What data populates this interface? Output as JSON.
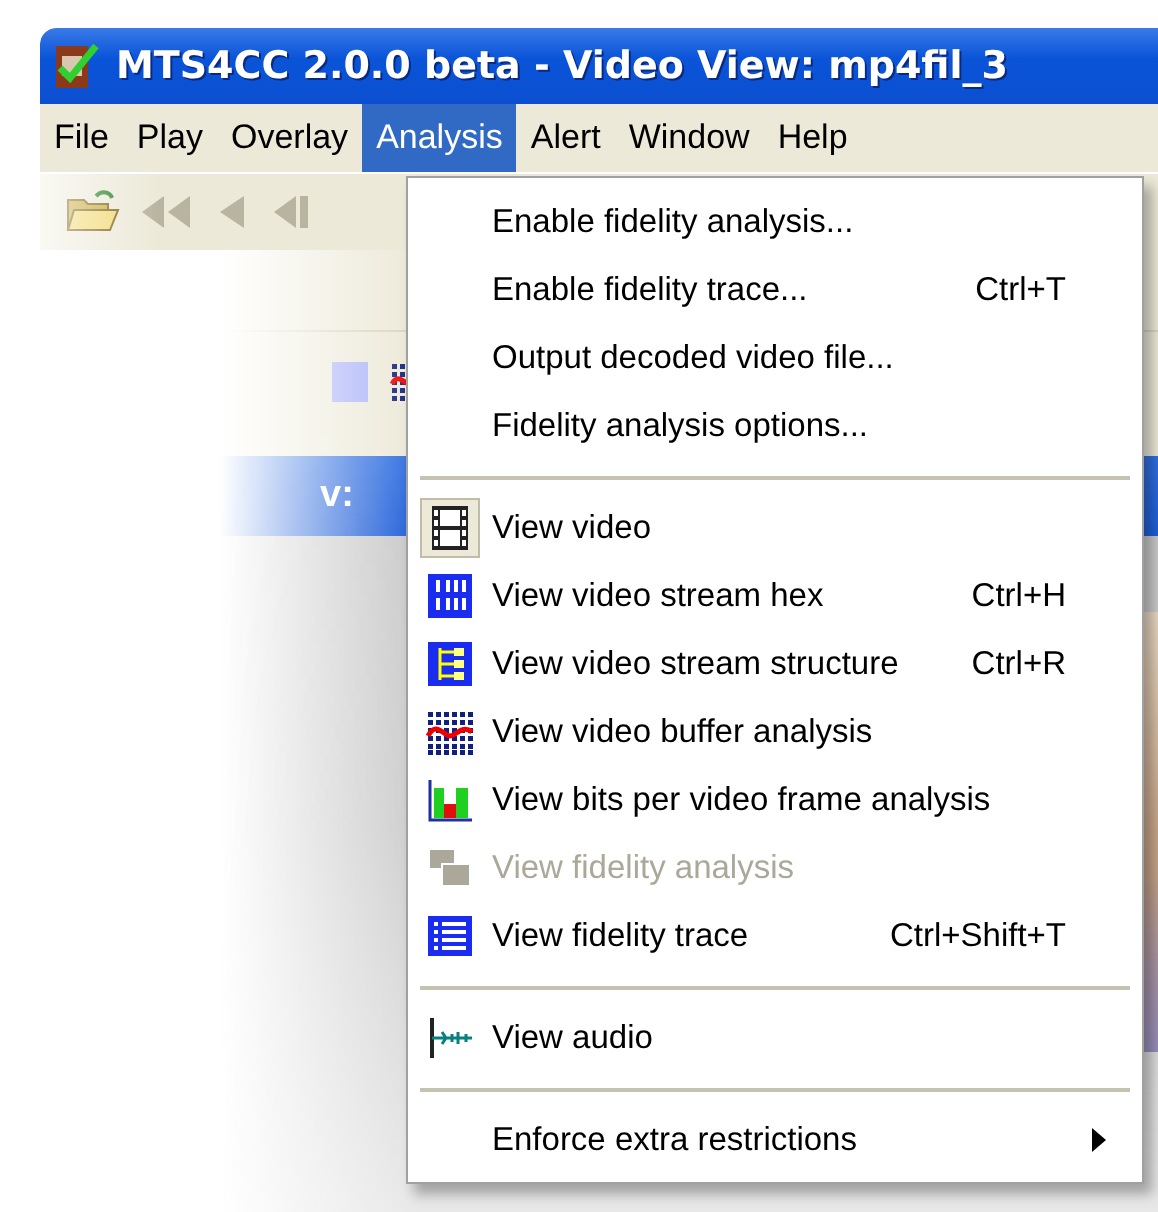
{
  "window": {
    "title": "MTS4CC 2.0.0 beta - Video View: mp4fil_3"
  },
  "menu_bar": [
    {
      "label": "File",
      "selected": false
    },
    {
      "label": "Play",
      "selected": false
    },
    {
      "label": "Overlay",
      "selected": false
    },
    {
      "label": "Analysis",
      "selected": true
    },
    {
      "label": "Alert",
      "selected": false
    },
    {
      "label": "Window",
      "selected": false
    },
    {
      "label": "Help",
      "selected": false
    }
  ],
  "child_window": {
    "title": "v:"
  },
  "analysis_menu": [
    {
      "kind": "item",
      "label": "Enable fidelity analysis...",
      "disabled": false
    },
    {
      "kind": "item",
      "label": "Enable fidelity trace...",
      "shortcut": "Ctrl+T",
      "disabled": false
    },
    {
      "kind": "item",
      "label": "Output decoded video file...",
      "disabled": false
    },
    {
      "kind": "item",
      "label": "Fidelity analysis options...",
      "disabled": false
    },
    {
      "kind": "separator"
    },
    {
      "kind": "icon_item",
      "label": "View video",
      "checked": true,
      "disabled": false
    },
    {
      "kind": "icon_item",
      "label": "View video stream hex",
      "shortcut": "Ctrl+H",
      "checked": false,
      "disabled": false
    },
    {
      "kind": "icon_item",
      "label": "View video stream structure",
      "shortcut": "Ctrl+R",
      "checked": false,
      "disabled": false
    },
    {
      "kind": "icon_item",
      "label": "View video buffer analysis",
      "checked": false,
      "disabled": false
    },
    {
      "kind": "icon_item",
      "label": "View bits per video frame analysis",
      "checked": false,
      "disabled": false
    },
    {
      "kind": "icon_item",
      "label": "View fidelity analysis",
      "checked": false,
      "disabled": true
    },
    {
      "kind": "icon_item",
      "label": "View fidelity trace",
      "shortcut": "Ctrl+Shift+T",
      "checked": false,
      "disabled": false
    },
    {
      "kind": "separator"
    },
    {
      "kind": "icon_item",
      "label": "View audio",
      "checked": false,
      "disabled": false
    },
    {
      "kind": "separator"
    },
    {
      "kind": "submenu",
      "label": "Enforce extra restrictions",
      "disabled": false
    }
  ]
}
